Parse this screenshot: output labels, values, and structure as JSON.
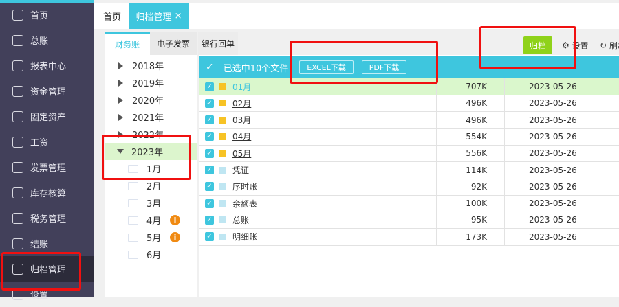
{
  "colors": {
    "accent": "#3ec6de",
    "sidebar": "#42405a",
    "archive_btn": "#8fd21a",
    "warn": "#f08a12",
    "selected_row": "#daf7cc"
  },
  "sidebar": {
    "items": [
      {
        "label": "首页",
        "icon": "home-icon"
      },
      {
        "label": "总账",
        "icon": "ledger-icon"
      },
      {
        "label": "报表中心",
        "icon": "chart-icon"
      },
      {
        "label": "资金管理",
        "icon": "money-bag-icon"
      },
      {
        "label": "固定资产",
        "icon": "building-icon"
      },
      {
        "label": "工资",
        "icon": "salary-icon"
      },
      {
        "label": "发票管理",
        "icon": "invoice-icon"
      },
      {
        "label": "库存核算",
        "icon": "warehouse-icon"
      },
      {
        "label": "税务管理",
        "icon": "tax-icon"
      },
      {
        "label": "结账",
        "icon": "checkout-icon"
      },
      {
        "label": "归档管理",
        "icon": "archive-icon",
        "active": true
      },
      {
        "label": "设置",
        "icon": "gear-icon"
      }
    ]
  },
  "tabs": {
    "home": "首页",
    "active": "归档管理",
    "close": "×"
  },
  "subtabs": [
    "财务账",
    "电子发票",
    "银行回单"
  ],
  "tree": {
    "years": [
      "2018年",
      "2019年",
      "2020年",
      "2021年",
      "2022年",
      "2023年"
    ],
    "months": [
      "1月",
      "2月",
      "3月",
      "4月",
      "5月",
      "6月"
    ],
    "info_mark": "i"
  },
  "toolbar": {
    "archive": "归档",
    "settings": "设置",
    "refresh": "刷新"
  },
  "selection": {
    "check": "✓",
    "text": "已选中10个文件",
    "excel": "EXCEL下载",
    "pdf": "PDF下载"
  },
  "rows": [
    {
      "name": "01月",
      "size": "707K",
      "date": "2023-05-26",
      "type": "folder"
    },
    {
      "name": "02月",
      "size": "496K",
      "date": "2023-05-26",
      "type": "folder"
    },
    {
      "name": "03月",
      "size": "496K",
      "date": "2023-05-26",
      "type": "folder"
    },
    {
      "name": "04月",
      "size": "554K",
      "date": "2023-05-26",
      "type": "folder"
    },
    {
      "name": "05月",
      "size": "556K",
      "date": "2023-05-26",
      "type": "folder"
    },
    {
      "name": "凭证",
      "size": "114K",
      "date": "2023-05-26",
      "type": "file"
    },
    {
      "name": "序时账",
      "size": "92K",
      "date": "2023-05-26",
      "type": "file"
    },
    {
      "name": "余额表",
      "size": "100K",
      "date": "2023-05-26",
      "type": "file"
    },
    {
      "name": "总账",
      "size": "95K",
      "date": "2023-05-26",
      "type": "file"
    },
    {
      "name": "明细账",
      "size": "173K",
      "date": "2023-05-26",
      "type": "file"
    }
  ]
}
